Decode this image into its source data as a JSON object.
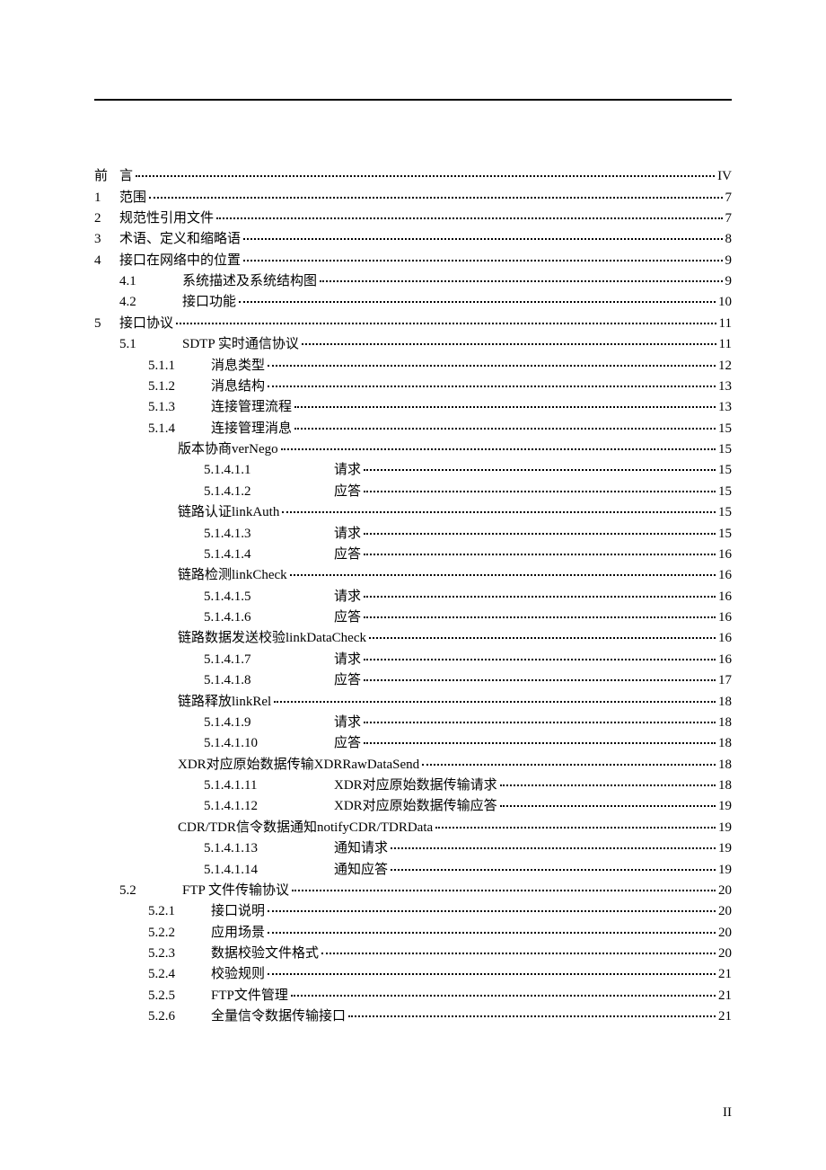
{
  "page_number_label": "II",
  "toc": [
    {
      "level": 0,
      "num": "前",
      "title": "言",
      "page": "IV"
    },
    {
      "level": 0,
      "num": "1",
      "title": "范围",
      "page": "7"
    },
    {
      "level": 0,
      "num": "2",
      "title": "规范性引用文件",
      "page": "7"
    },
    {
      "level": 0,
      "num": "3",
      "title": "术语、定义和缩略语",
      "page": "8"
    },
    {
      "level": 0,
      "num": "4",
      "title": "接口在网络中的位置",
      "page": "9"
    },
    {
      "level": 1,
      "num": "4.1",
      "title": "系统描述及系统结构图",
      "page": "9"
    },
    {
      "level": 1,
      "num": "4.2",
      "title": "接口功能",
      "page": "10"
    },
    {
      "level": 0,
      "num": "5",
      "title": "接口协议",
      "page": "11"
    },
    {
      "level": 1,
      "num": "5.1",
      "title": "SDTP 实时通信协议",
      "page": "11"
    },
    {
      "level": 2,
      "num": "5.1.1",
      "title": "消息类型",
      "page": "12"
    },
    {
      "level": 2,
      "num": "5.1.2",
      "title": "消息结构",
      "page": "13"
    },
    {
      "level": 2,
      "num": "5.1.3",
      "title": "连接管理流程",
      "page": "13"
    },
    {
      "level": 2,
      "num": "5.1.4",
      "title": "连接管理消息",
      "page": "15"
    },
    {
      "level": 3,
      "num": "",
      "title": "版本协商verNego",
      "page": "15"
    },
    {
      "level": 4,
      "num": "5.1.4.1.1",
      "title": "请求",
      "page": "15"
    },
    {
      "level": 4,
      "num": "5.1.4.1.2",
      "title": "应答",
      "page": "15"
    },
    {
      "level": 3,
      "num": "",
      "title": "链路认证linkAuth",
      "page": "15"
    },
    {
      "level": 4,
      "num": "5.1.4.1.3",
      "title": "请求",
      "page": "15"
    },
    {
      "level": 4,
      "num": "5.1.4.1.4",
      "title": "应答",
      "page": "16"
    },
    {
      "level": 3,
      "num": "",
      "title": "链路检测linkCheck",
      "page": "16"
    },
    {
      "level": 4,
      "num": "5.1.4.1.5",
      "title": "请求",
      "page": "16"
    },
    {
      "level": 4,
      "num": "5.1.4.1.6",
      "title": "应答",
      "page": "16"
    },
    {
      "level": 3,
      "num": "",
      "title": "链路数据发送校验linkDataCheck",
      "page": "16"
    },
    {
      "level": 4,
      "num": "5.1.4.1.7",
      "title": "请求",
      "page": "16"
    },
    {
      "level": 4,
      "num": "5.1.4.1.8",
      "title": "应答",
      "page": "17"
    },
    {
      "level": 3,
      "num": "",
      "title": "链路释放linkRel",
      "page": "18"
    },
    {
      "level": 4,
      "num": "5.1.4.1.9",
      "title": "请求",
      "page": "18"
    },
    {
      "level": 4,
      "num": "5.1.4.1.10",
      "title": "应答",
      "page": "18"
    },
    {
      "level": 3,
      "num": "",
      "title": "XDR对应原始数据传输XDRRawDataSend",
      "page": "18"
    },
    {
      "level": 4,
      "num": "5.1.4.1.11",
      "title": "XDR对应原始数据传输请求",
      "page": "18"
    },
    {
      "level": 4,
      "num": "5.1.4.1.12",
      "title": "XDR对应原始数据传输应答",
      "page": "19"
    },
    {
      "level": 3,
      "num": "",
      "title": "CDR/TDR信令数据通知notifyCDR/TDRData",
      "page": "19"
    },
    {
      "level": 4,
      "num": "5.1.4.1.13",
      "title": "通知请求",
      "page": "19"
    },
    {
      "level": 4,
      "num": "5.1.4.1.14",
      "title": "通知应答",
      "page": "19"
    },
    {
      "level": 1,
      "num": "5.2",
      "title": "FTP 文件传输协议",
      "page": "20"
    },
    {
      "level": 2,
      "num": "5.2.1",
      "title": "接口说明",
      "page": "20"
    },
    {
      "level": 2,
      "num": "5.2.2",
      "title": "应用场景",
      "page": "20"
    },
    {
      "level": 2,
      "num": "5.2.3",
      "title": "数据校验文件格式",
      "page": "20"
    },
    {
      "level": 2,
      "num": "5.2.4",
      "title": "校验规则",
      "page": "21"
    },
    {
      "level": 2,
      "num": "5.2.5",
      "title": "FTP文件管理",
      "page": "21"
    },
    {
      "level": 2,
      "num": "5.2.6",
      "title": "全量信令数据传输接口",
      "page": "21"
    }
  ]
}
